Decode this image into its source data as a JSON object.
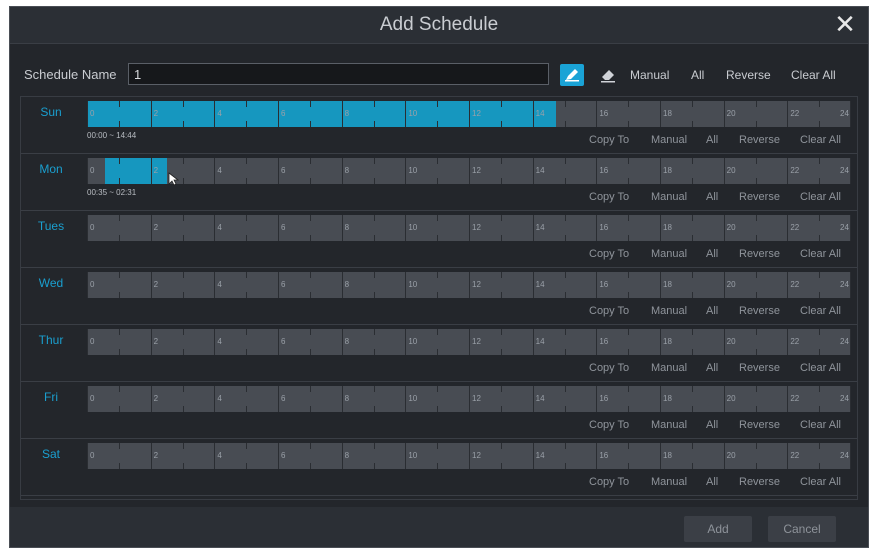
{
  "dialog": {
    "title": "Add Schedule"
  },
  "name_row": {
    "label": "Schedule Name",
    "value": "1"
  },
  "top_actions": {
    "manual": "Manual",
    "all": "All",
    "reverse": "Reverse",
    "clear_all": "Clear All"
  },
  "hour_labels": [
    "0",
    "2",
    "4",
    "6",
    "8",
    "10",
    "12",
    "14",
    "16",
    "18",
    "20",
    "22",
    "24"
  ],
  "row_actions": {
    "copy_to": "Copy To",
    "manual": "Manual",
    "all": "All",
    "reverse": "Reverse",
    "clear_all": "Clear All"
  },
  "days": [
    {
      "id": "sun",
      "label": "Sun",
      "range_text": "00:00 ~ 14:44",
      "segments": [
        {
          "start_hour": 0,
          "end_hour": 14.73
        }
      ]
    },
    {
      "id": "mon",
      "label": "Mon",
      "range_text": "00:35 ~ 02:31",
      "segments": [
        {
          "start_hour": 0.58,
          "end_hour": 2.52
        }
      ]
    },
    {
      "id": "tue",
      "label": "Tues",
      "range_text": "",
      "segments": []
    },
    {
      "id": "wed",
      "label": "Wed",
      "range_text": "",
      "segments": []
    },
    {
      "id": "thu",
      "label": "Thur",
      "range_text": "",
      "segments": []
    },
    {
      "id": "fri",
      "label": "Fri",
      "range_text": "",
      "segments": []
    },
    {
      "id": "sat",
      "label": "Sat",
      "range_text": "",
      "segments": []
    }
  ],
  "footer": {
    "add": "Add",
    "cancel": "Cancel"
  },
  "colors": {
    "accent": "#1697bf",
    "day_label": "#1a9fcf"
  }
}
